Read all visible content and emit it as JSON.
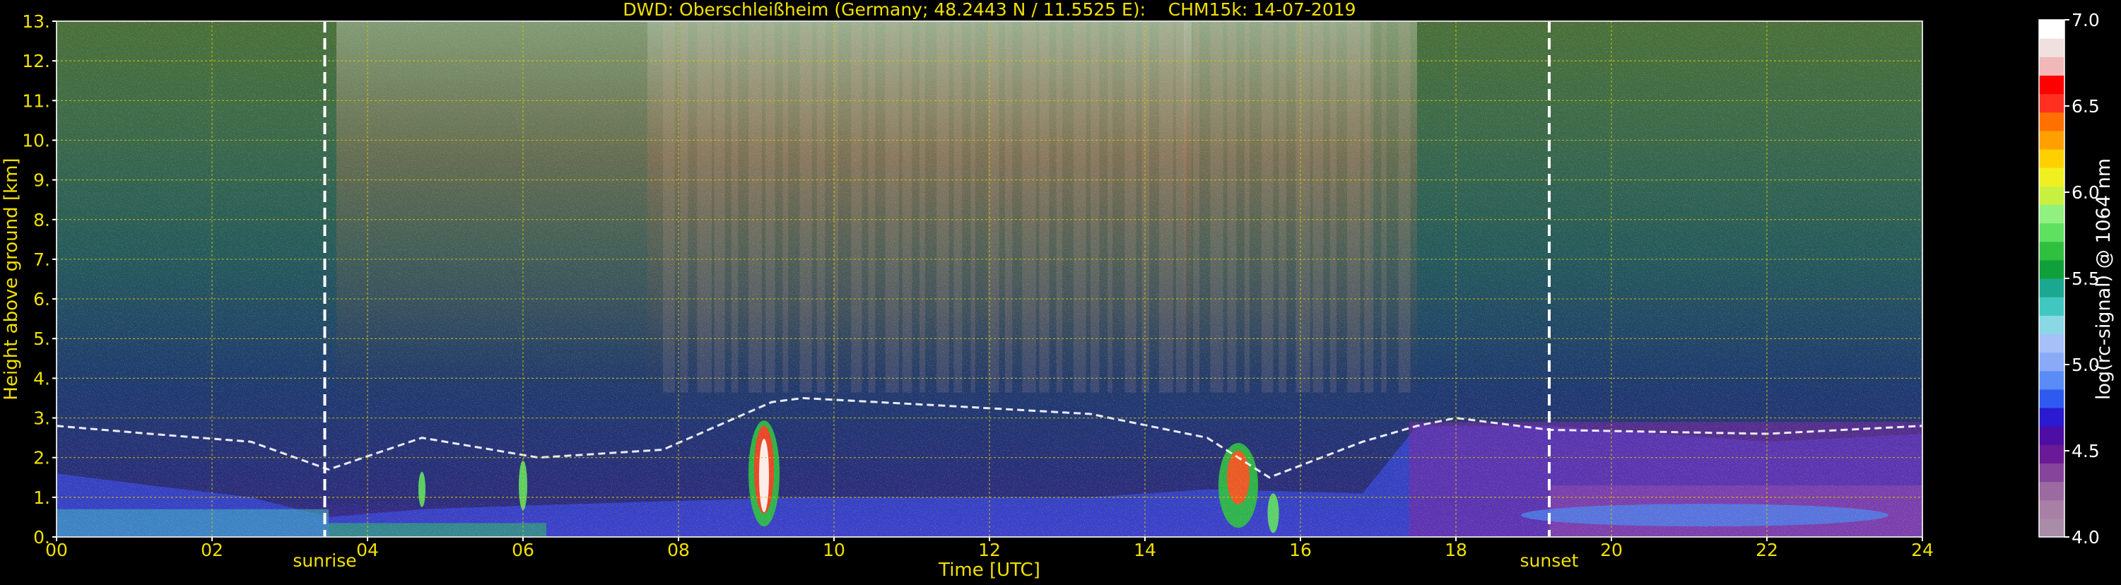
{
  "chart_data": {
    "type": "heatmap",
    "title": "DWD: Oberschleißheim (Germany; 48.2443 N / 11.5525 E):    CHM15k: 14-07-2019",
    "xlabel": "Time [UTC]",
    "ylabel": "Height above ground [km]",
    "xlim": [
      0,
      24
    ],
    "ylim": [
      0,
      13
    ],
    "xticks": [
      "00",
      "02",
      "04",
      "06",
      "08",
      "10",
      "12",
      "14",
      "16",
      "18",
      "20",
      "22",
      "24"
    ],
    "yticks": [
      "0.",
      "1.",
      "2.",
      "3.",
      "4.",
      "5.",
      "6.",
      "7.",
      "8.",
      "9.",
      "10.",
      "11.",
      "12.",
      "13."
    ],
    "grid": true,
    "markers": [
      {
        "label": "sunrise",
        "x": 3.45
      },
      {
        "label": "sunset",
        "x": 19.2
      }
    ],
    "colorbar": {
      "label": "log(rc-signal) @ 1064 nm",
      "range": [
        4.0,
        7.0
      ],
      "ticks": [
        "4.0",
        "4.5",
        "5.0",
        "5.5",
        "6.0",
        "6.5",
        "7.0"
      ],
      "colors": [
        "#a98ca8",
        "#a880a6",
        "#9a6aa0",
        "#86449a",
        "#6a1a96",
        "#4d0ea6",
        "#2a1ad0",
        "#2f5af0",
        "#5a8cf5",
        "#8aaaf7",
        "#a8c0f8",
        "#8ad8e6",
        "#40c8c0",
        "#1aa890",
        "#10a03a",
        "#30c040",
        "#60e060",
        "#90f080",
        "#c8f040",
        "#f0f020",
        "#ffd000",
        "#ffa000",
        "#ff7000",
        "#ff3020",
        "#ff0000",
        "#f0b8b8",
        "#f0e0e0",
        "#ffffff"
      ]
    },
    "layers": [
      {
        "x": [
          0.0,
          1.2,
          2.5,
          3.5,
          4.7,
          6.2,
          7.8,
          9.2,
          9.6,
          11.5,
          13.3,
          14.8,
          15.6,
          16.8,
          17.5,
          18.0,
          19.2,
          22.0,
          24.0
        ],
        "y": [
          2.8,
          2.6,
          2.4,
          1.7,
          2.5,
          2.0,
          2.2,
          3.4,
          3.5,
          3.3,
          3.1,
          2.5,
          1.5,
          2.4,
          2.8,
          3.0,
          2.7,
          2.6,
          2.8
        ]
      }
    ]
  }
}
